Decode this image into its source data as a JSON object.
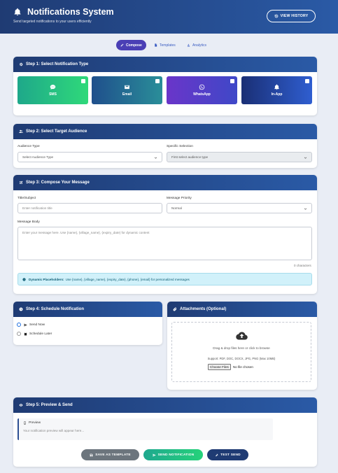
{
  "header": {
    "title": "Notifications System",
    "subtitle": "Send targeted notifications to your users efficiently",
    "history_button": "VIEW HISTORY"
  },
  "tabs": [
    {
      "label": "Compose",
      "active": true
    },
    {
      "label": "Templates",
      "active": false
    },
    {
      "label": "Analytics",
      "active": false
    }
  ],
  "step1": {
    "title": "Step 1: Select Notification Type",
    "types": [
      {
        "label": "SMS",
        "icon": "sms-icon",
        "color_from": "#1ea88a",
        "color_to": "#2fd97a"
      },
      {
        "label": "Email",
        "icon": "envelope-icon",
        "color_from": "#1f4f8c",
        "color_to": "#2a8e99"
      },
      {
        "label": "WhatsApp",
        "icon": "whatsapp-icon",
        "color_from": "#6a35c9",
        "color_to": "#3f48c8"
      },
      {
        "label": "In-App",
        "icon": "bell-icon",
        "color_from": "#1a2f75",
        "color_to": "#2f5ed0"
      }
    ]
  },
  "step2": {
    "title": "Step 2: Select Target Audience",
    "audience_label": "Audience Type",
    "audience_value": "Select Audience Type",
    "specific_label": "Specific Selection",
    "specific_value": "First select audience type"
  },
  "step3": {
    "title": "Step 3: Compose Your Message",
    "subject_label": "Title/Subject",
    "subject_placeholder": "Enter notification title",
    "priority_label": "Message Priority",
    "priority_value": "Normal",
    "body_label": "Message Body",
    "body_placeholder": "Enter your message here. Use {name}, {village_name}, {expiry_date} for dynamic content",
    "counter": "0 characters",
    "info_title": "Dynamic Placeholders:",
    "info_text": "Use {name}, {village_name}, {expiry_date}, {phone}, {email} for personalized messages"
  },
  "step4": {
    "title": "Step 4: Schedule Notification",
    "options": [
      {
        "label": "Send Now",
        "selected": true
      },
      {
        "label": "Schedule Later",
        "selected": false
      }
    ]
  },
  "attachments": {
    "title": "Attachments (Optional)",
    "drop_text": "Drag & drop files here or click to browse",
    "support_text": "Support: PDF, DOC, DOCX, JPG, PNG (Max 10MB)",
    "choose_label": "Choose Files",
    "no_file": "No file chosen"
  },
  "step5": {
    "title": "Step 5: Preview & Send",
    "preview_label": "Preview",
    "preview_placeholder": "Your notification preview will appear here...",
    "buttons": {
      "save_template": "SAVE AS TEMPLATE",
      "send": "SEND NOTIFICATION",
      "test": "TEST SEND"
    }
  },
  "colors": {
    "header": "#1f3b73",
    "accent": "#4a3fb5",
    "save_button": "#6c757d",
    "send_button": "#1fbf8f",
    "test_button": "#1f3b73",
    "info_bg": "#d1f1fa"
  }
}
